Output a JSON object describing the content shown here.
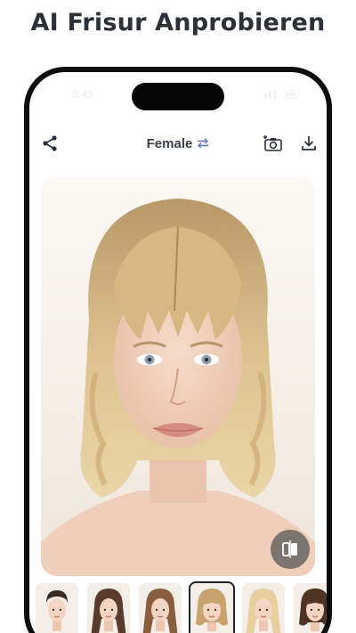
{
  "headline": "AI Frisur Anprobieren",
  "status_bar": {
    "time": "9:41"
  },
  "toolbar": {
    "gender_label": "Female",
    "icons": [
      "share-icon",
      "swap-icon",
      "camera-add-icon",
      "download-icon"
    ]
  },
  "preview": {
    "subject": "woman-blonde-bob-with-bangs",
    "compare_icon": "compare-icon"
  },
  "styles": {
    "selected_index": 3,
    "items": [
      {
        "hair": "#3b2a22",
        "style": "buzz"
      },
      {
        "hair": "#5a3a2a",
        "style": "long"
      },
      {
        "hair": "#8a5e3c",
        "style": "long"
      },
      {
        "hair": "#c9a36e",
        "style": "bob-bangs"
      },
      {
        "hair": "#e8cf9c",
        "style": "long"
      },
      {
        "hair": "#4e3324",
        "style": "bob-bangs"
      }
    ]
  },
  "colors": {
    "accent": "#2c3038",
    "phone_frame": "#0d0d0f",
    "blonde": "#d9bd88"
  }
}
